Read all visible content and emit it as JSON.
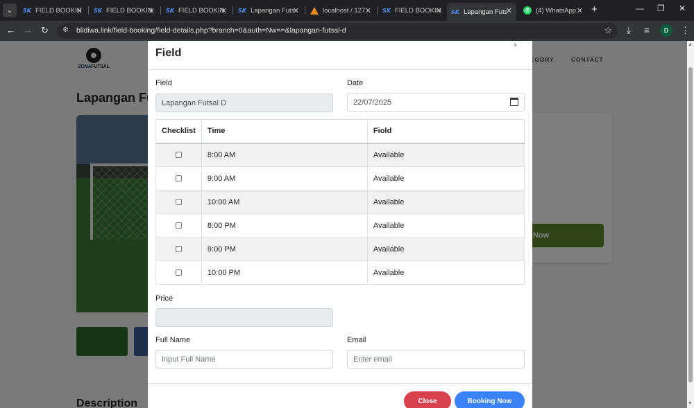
{
  "browser": {
    "tabs": [
      {
        "title": "FIELD BOOKIN",
        "icon": "sk-icon",
        "active": false
      },
      {
        "title": "FIELD BOOKIN",
        "icon": "sk-icon",
        "active": false
      },
      {
        "title": "FIELD BOOKIN",
        "icon": "sk-icon",
        "active": false
      },
      {
        "title": "Lapangan Futs",
        "icon": "sk-icon",
        "active": false
      },
      {
        "title": "localhost / 127",
        "icon": "phpmyadmin-icon",
        "active": false
      },
      {
        "title": "FIELD BOOKIN",
        "icon": "sk-icon",
        "active": false
      },
      {
        "title": "Lapangan Futs",
        "icon": "sk-icon",
        "active": true
      },
      {
        "title": "(4) WhatsApp",
        "icon": "whatsapp-icon",
        "active": false
      }
    ],
    "url": "blidiwa.link/field-booking/field-details.php?branch=0&auth=Nw==&lapangan-futsal-d",
    "profile_initial": "D"
  },
  "page": {
    "logo_text_1": "ZONA",
    "logo_text_2": "FUTSAL",
    "nav": {
      "category": "TEGORY",
      "contact": "CONTACT"
    },
    "title": "Lapangan Futs",
    "card_button": "Now",
    "description_title": "Description"
  },
  "modal": {
    "title": "Field",
    "close_x": "×",
    "field_label": "Field",
    "field_value": "Lapangan Futsal D",
    "date_label": "Date",
    "date_value": "22/07/2025",
    "table": {
      "headers": [
        "Checklist",
        "Time",
        "Fiold"
      ],
      "rows": [
        {
          "time": "8:00 AM",
          "status": "Available"
        },
        {
          "time": "9:00 AM",
          "status": "Available"
        },
        {
          "time": "10:00 AM",
          "status": "Available"
        },
        {
          "time": "8:00 PM",
          "status": "Available"
        },
        {
          "time": "9:00 PM",
          "status": "Available"
        },
        {
          "time": "10:00 PM",
          "status": "Available"
        }
      ]
    },
    "price_label": "Price",
    "price_value": "",
    "fullname_label": "Full Name",
    "fullname_placeholder": "Input Full Name",
    "email_label": "Email",
    "email_placeholder": "Enter email",
    "close_button": "Close",
    "booking_button": "Booking Now"
  },
  "colors": {
    "close_button": "#d9414f",
    "booking_button": "#3b82f6",
    "card_button": "#5f8a30"
  }
}
